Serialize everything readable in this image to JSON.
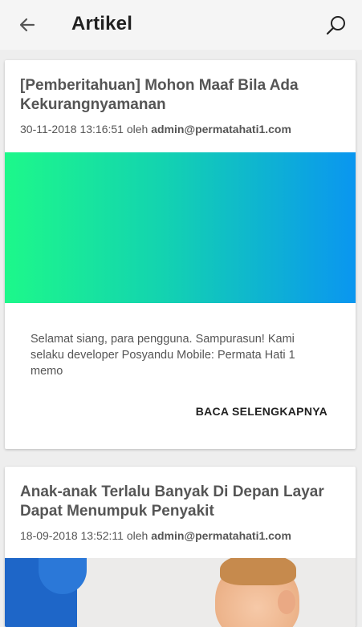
{
  "app_bar": {
    "title": "Artikel",
    "back_icon": "arrow-left-icon",
    "search_icon": "search-icon"
  },
  "articles": [
    {
      "title": "[Pemberitahuan] Mohon Maaf Bila Ada Kekurangnyamanan",
      "date": "30-11-2018 13:16:51",
      "by": "oleh",
      "author": "admin@permatahati1.com",
      "image": "gradient-banner",
      "excerpt": "Selamat siang, para pengguna. Sampurasun! Kami selaku developer Posyandu Mobile: Permata Hati 1 memo",
      "read_more": "BACA SELENGKAPNYA"
    },
    {
      "title": "Anak-anak Terlalu Banyak Di Depan Layar Dapat Menumpuk Penyakit",
      "date": "18-09-2018 13:52:11",
      "by": "oleh",
      "author": "admin@permatahati1.com",
      "image": "child-photo"
    }
  ],
  "colors": {
    "gradient_start": "#1df88a",
    "gradient_end": "#0a96f0",
    "title_text": "#555555"
  }
}
